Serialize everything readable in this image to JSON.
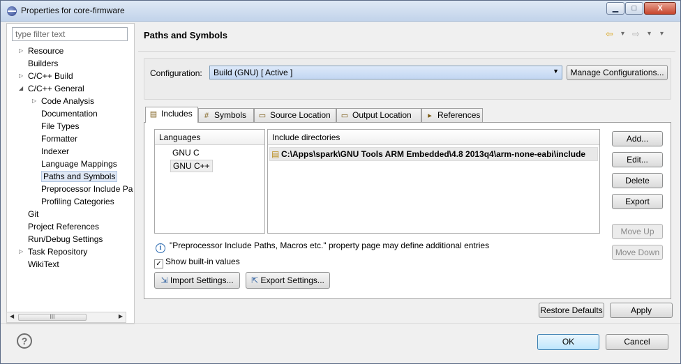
{
  "window": {
    "title": "Properties for core-firmware",
    "minimize": "▁",
    "maximize": "□",
    "close": "X"
  },
  "filter": {
    "placeholder": "type filter text"
  },
  "tree": [
    {
      "label": "Resource",
      "indent": 0,
      "arrow": "collapsed"
    },
    {
      "label": "Builders",
      "indent": 0,
      "arrow": "none"
    },
    {
      "label": "C/C++ Build",
      "indent": 0,
      "arrow": "collapsed"
    },
    {
      "label": "C/C++ General",
      "indent": 0,
      "arrow": "expanded"
    },
    {
      "label": "Code Analysis",
      "indent": 1,
      "arrow": "collapsed"
    },
    {
      "label": "Documentation",
      "indent": 1,
      "arrow": "none"
    },
    {
      "label": "File Types",
      "indent": 1,
      "arrow": "none"
    },
    {
      "label": "Formatter",
      "indent": 1,
      "arrow": "none"
    },
    {
      "label": "Indexer",
      "indent": 1,
      "arrow": "none"
    },
    {
      "label": "Language Mappings",
      "indent": 1,
      "arrow": "none"
    },
    {
      "label": "Paths and Symbols",
      "indent": 1,
      "arrow": "none",
      "selected": true
    },
    {
      "label": "Preprocessor Include Pa",
      "indent": 1,
      "arrow": "none"
    },
    {
      "label": "Profiling Categories",
      "indent": 1,
      "arrow": "none"
    },
    {
      "label": "Git",
      "indent": 0,
      "arrow": "none"
    },
    {
      "label": "Project References",
      "indent": 0,
      "arrow": "none"
    },
    {
      "label": "Run/Debug Settings",
      "indent": 0,
      "arrow": "none"
    },
    {
      "label": "Task Repository",
      "indent": 0,
      "arrow": "collapsed"
    },
    {
      "label": "WikiText",
      "indent": 0,
      "arrow": "none"
    }
  ],
  "scroll": {
    "left": "◀",
    "right": "▶",
    "thumb": "III"
  },
  "page": {
    "title": "Paths and Symbols",
    "nav": {
      "back": "⇦",
      "back_menu": "▾",
      "forward": "⇨",
      "forward_menu": "▾",
      "view_menu": "▾"
    }
  },
  "configuration": {
    "label": "Configuration:",
    "value": "Build (GNU)  [ Active ]",
    "caret": "▼",
    "manage_button": "Manage Configurations..."
  },
  "tabs": [
    {
      "label": "Includes",
      "icon": "▤",
      "icon_name": "includes-icon",
      "active": true
    },
    {
      "label": "Symbols",
      "icon": "#",
      "icon_name": "hash-icon"
    },
    {
      "label": "Source Location",
      "icon": "▭",
      "icon_name": "folder-icon"
    },
    {
      "label": "Output Location",
      "icon": "▭",
      "icon_name": "folder-icon"
    },
    {
      "label": "References",
      "icon": "▸",
      "icon_name": "references-icon"
    }
  ],
  "languages": {
    "header": "Languages",
    "items": [
      "GNU C",
      "GNU C++"
    ],
    "selected": "GNU C++"
  },
  "include_dirs": {
    "header": "Include directories",
    "rows": [
      "C:\\Apps\\spark\\GNU Tools ARM Embedded\\4.8 2013q4\\arm-none-eabi\\include"
    ],
    "folder_icon": "▤"
  },
  "side_buttons": [
    {
      "label": "Add...",
      "enabled": true
    },
    {
      "label": "Edit...",
      "enabled": true
    },
    {
      "label": "Delete",
      "enabled": true
    },
    {
      "label": "Export",
      "enabled": true
    },
    {
      "label": "Move Up",
      "enabled": false
    },
    {
      "label": "Move Down",
      "enabled": false
    }
  ],
  "info": {
    "icon": "i",
    "text": "\"Preprocessor Include Paths, Macros etc.\" property page may define additional entries"
  },
  "show_builtin": {
    "label": "Show built-in values",
    "checked": true,
    "mark": "✓"
  },
  "import_button": "Import Settings...",
  "export_button": "Export Settings...",
  "import_icon": "⇲",
  "export_icon": "⇱",
  "restore_button": "Restore Defaults",
  "apply_button": "Apply",
  "help_icon": "?",
  "ok_button": "OK",
  "cancel_button": "Cancel"
}
